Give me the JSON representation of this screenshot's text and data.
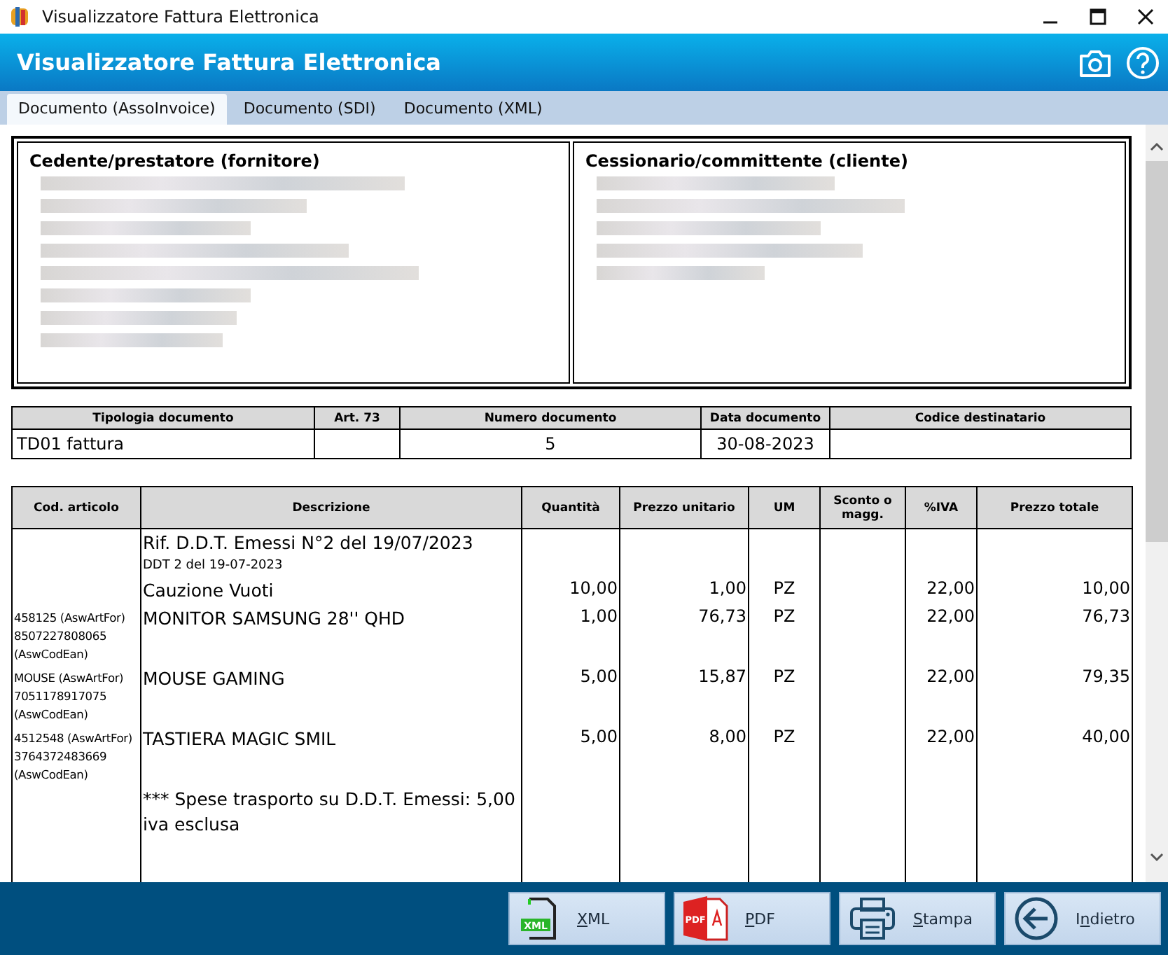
{
  "window": {
    "title": "Visualizzatore Fattura Elettronica"
  },
  "header": {
    "title": "Visualizzatore Fattura Elettronica"
  },
  "tabs": [
    {
      "label": "Documento (AssoInvoice)",
      "selected": true
    },
    {
      "label": "Documento (SDI)",
      "selected": false
    },
    {
      "label": "Documento (XML)",
      "selected": false
    }
  ],
  "parties": [
    {
      "title": "Cedente/prestatore (fornitore)"
    },
    {
      "title": "Cessionario/committente (cliente)"
    }
  ],
  "document_table": {
    "columns": [
      "Tipologia documento",
      "Art. 73",
      "Numero documento",
      "Data documento",
      "Codice destinatario"
    ],
    "row": {
      "document_type": "TD01 fattura",
      "document_number": "5",
      "document_date": "30-08-2023"
    }
  },
  "items_table": {
    "columns": [
      "Cod. articolo",
      "Descrizione",
      "Quantità",
      "Prezzo unitario",
      "UM",
      "Sconto o magg.",
      "%IVA",
      "Prezzo totale"
    ],
    "rows": [
      {
        "code": "",
        "description": "Rif. D.D.T. Emessi N°2 del 19/07/2023",
        "note": "DDT 2 del 19-07-2023",
        "quantity": "",
        "unit_price": "",
        "um": "",
        "discount": "",
        "vat": "",
        "total": ""
      },
      {
        "code": "",
        "description": "Cauzione Vuoti",
        "quantity": "10,00",
        "unit_price": "1,00",
        "um": "PZ",
        "discount": "",
        "vat": "22,00",
        "total": "10,00"
      },
      {
        "code": "458125 (AswArtFor) 8507227808065 (AswCodEan)",
        "description": "MONITOR SAMSUNG 28'' QHD",
        "quantity": "1,00",
        "unit_price": "76,73",
        "um": "PZ",
        "discount": "",
        "vat": "22,00",
        "total": "76,73"
      },
      {
        "code": "MOUSE (AswArtFor) 7051178917075 (AswCodEan)",
        "description": "MOUSE GAMING",
        "quantity": "5,00",
        "unit_price": "15,87",
        "um": "PZ",
        "discount": "",
        "vat": "22,00",
        "total": "79,35"
      },
      {
        "code": "4512548 (AswArtFor) 3764372483669 (AswCodEan)",
        "description": "TASTIERA MAGIC SMIL",
        "quantity": "5,00",
        "unit_price": "8,00",
        "um": "PZ",
        "discount": "",
        "vat": "22,00",
        "total": "40,00"
      },
      {
        "code": "",
        "description": "*** Spese trasporto su D.D.T. Emessi: 5,00 iva esclusa",
        "quantity": "",
        "unit_price": "",
        "um": "",
        "discount": "",
        "vat": "",
        "total": ""
      }
    ]
  },
  "buttons": [
    {
      "kind": "xml",
      "icon_text": "XML",
      "mnemonic": "X",
      "label_end": "ML"
    },
    {
      "kind": "pdf",
      "icon_text": "PDF",
      "mnemonic": "P",
      "label_end": "DF"
    },
    {
      "kind": "print",
      "mnemonic": "S",
      "label_end": "tampa"
    },
    {
      "kind": "back",
      "label_start": "I",
      "mnemonic": "n",
      "label_end": "dietro"
    }
  ]
}
